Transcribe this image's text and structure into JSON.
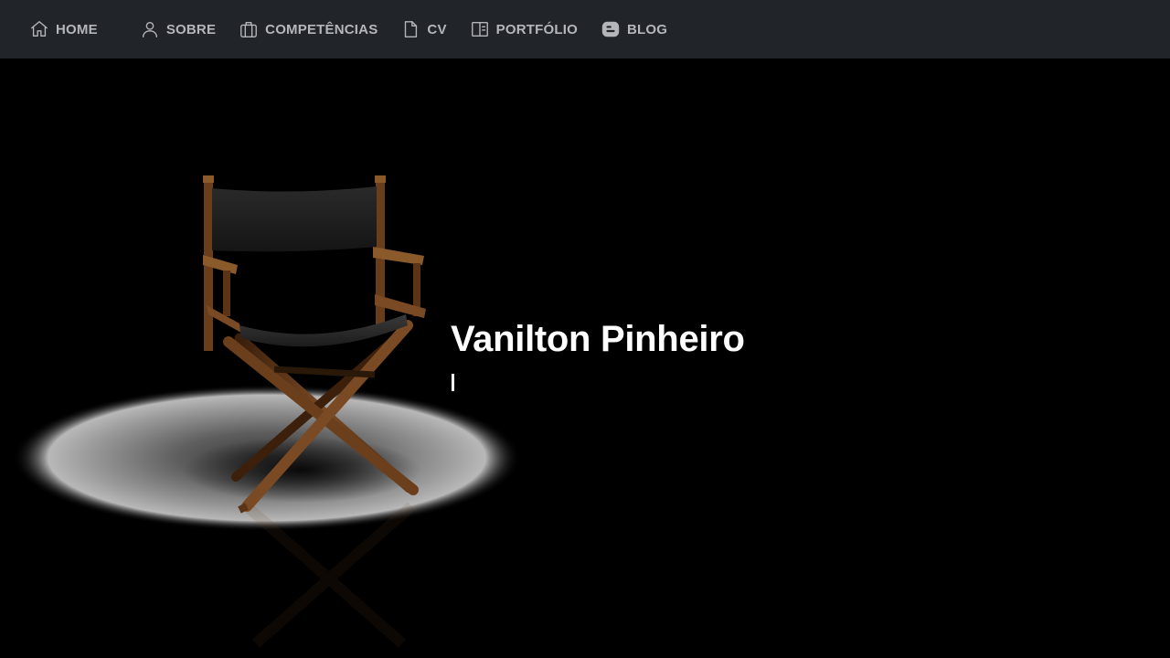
{
  "nav": {
    "items": [
      {
        "id": "home",
        "label": "HOME",
        "icon": "home-icon"
      },
      {
        "id": "sobre",
        "label": "SOBRE",
        "icon": "user-icon"
      },
      {
        "id": "competencias",
        "label": "COMPETÊNCIAS",
        "icon": "briefcase-icon"
      },
      {
        "id": "cv",
        "label": "CV",
        "icon": "file-icon"
      },
      {
        "id": "portfolio",
        "label": "PORTFÓLIO",
        "icon": "layout-icon"
      },
      {
        "id": "blog",
        "label": "BLOG",
        "icon": "blogger-icon"
      }
    ]
  },
  "hero": {
    "name": "Vanilton Pinheiro",
    "typed_text": "",
    "image": "directors-chair-spotlight"
  },
  "colors": {
    "navbar_bg": "#212529",
    "nav_text": "#b4b6ba",
    "hero_bg": "#000000",
    "hero_text": "#ffffff"
  }
}
